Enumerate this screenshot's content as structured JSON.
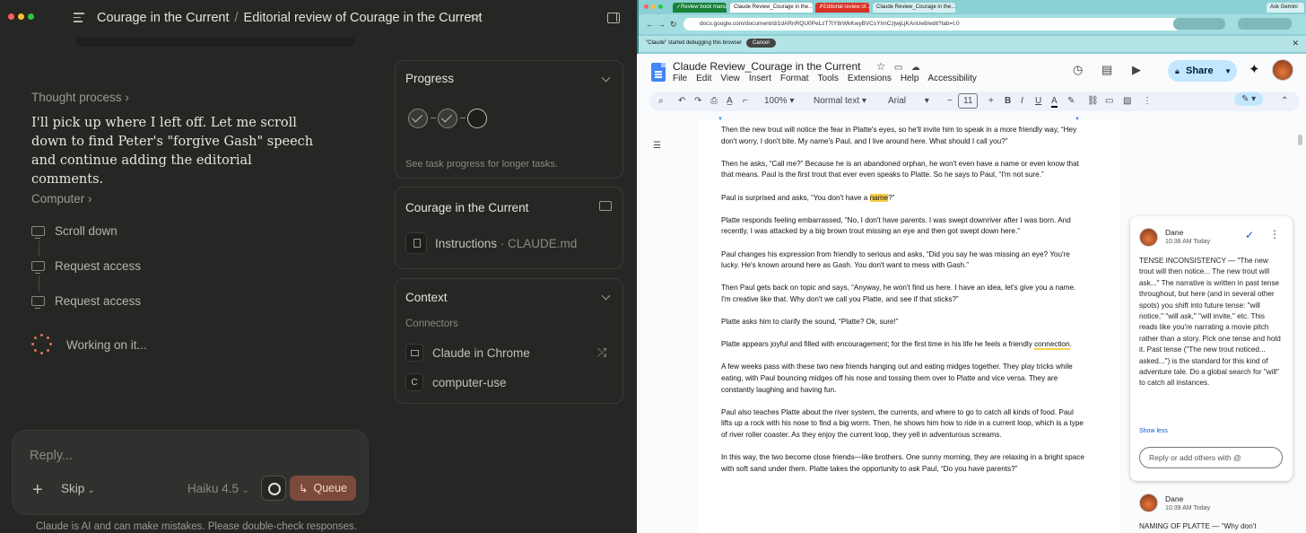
{
  "claude": {
    "breadcrumb": {
      "project": "Courage in the Current",
      "separator": "/",
      "chat": "Editorial review of Courage in the Current"
    },
    "thought_process": "Thought process",
    "message": "I'll pick up where I left off. Let me scroll down to find Peter's \"forgive Gash\" speech and continue adding the editorial comments.",
    "computer_label": "Computer",
    "steps": [
      "Scroll down",
      "Request access",
      "Request access"
    ],
    "working": "Working on it...",
    "progress": {
      "title": "Progress",
      "hint": "See task progress for longer tasks."
    },
    "project_card": {
      "title": "Courage in the Current",
      "file": "Instructions",
      "file_sep": " · ",
      "file_name": "CLAUDE.md"
    },
    "context": {
      "title": "Context",
      "connectors_label": "Connectors",
      "connectors": [
        {
          "name": "Claude in Chrome",
          "icon": "monitor-icon"
        },
        {
          "name": "computer-use",
          "icon": "c-icon"
        }
      ]
    },
    "composer": {
      "placeholder": "Reply...",
      "skip": "Skip",
      "model": "Haiku 4.5",
      "queue": "Queue"
    },
    "disclaimer": "Claude is AI and can make mistakes. Please double-check responses."
  },
  "browser": {
    "tabs": [
      "✓Review book manu…",
      "Claude Review_Courage in the…",
      "✗Editorial review of…",
      "Claude Review_Courage in the…",
      "Ask Gemini"
    ],
    "tab_colors": [
      "#188038",
      "#ffffff",
      "#d93025",
      "#d7f0f1",
      "#d7f0f1"
    ],
    "url": "docs.google.com/document/d/1dARnRQU0PeLzT7tY8rWkKwyBVCsYImCzjwjLjKAnUe8/edit?tab=t.0",
    "debug_text": "\"Claude\" started debugging this browser",
    "cancel": "Cancel"
  },
  "doc": {
    "title": "Claude Review_Courage in the Current",
    "menu": [
      "File",
      "Edit",
      "View",
      "Insert",
      "Format",
      "Tools",
      "Extensions",
      "Help",
      "Accessibility"
    ],
    "share": "Share",
    "zoom": "100%",
    "style": "Normal text",
    "font": "Arial",
    "font_size": "11",
    "paragraphs": {
      "p1": "Then the new trout will notice the fear in Platte's eyes, so he'll invite him to speak in a more friendly way, “Hey don't worry, I don't bite. My name's Paul, and I live around here. What should I call you?”",
      "p2": "Then he asks, “Call me?” Because he is an abandoned orphan, he won't even have a name or even know that that means. Paul is the first trout that ever even speaks to Platte. So he says to Paul, “I'm not sure.”",
      "p3a": "Paul is surprised and asks, “You don't have a ",
      "p3hl": "name",
      "p3b": "?”",
      "p4": "Platte responds feeling embarrassed, “No, I don't have parents. I was swept downriver after I was born. And recently, I was attacked by a big brown trout missing an eye and then got swept down here.”",
      "p5": "Paul changes his expression from friendly to serious and asks, “Did you say he was missing an eye? You're lucky. He's known around here as Gash. You don't want to mess with Gash.”",
      "p6": "Then Paul gets back on topic and says, “Anyway, he won't find us here. I have an idea, let's give you a name. I'm creative like that. Why don't we call you Platte, and see if that sticks?”",
      "p7": "Platte asks him to clarify the sound, “Platte? Ok, sure!”",
      "p8a": "Platte appears joyful and filled with encouragement; for the first time in his life he feels a friendly ",
      "p8hl": "connection",
      "p8b": ".",
      "p9": "A few weeks pass with these two new friends hanging out and eating midges together. They play tricks while eating, with Paul bouncing midges off his nose and tossing them over to Platte and vice versa. They are constantly laughing and having fun.",
      "p10": "Paul also teaches Platte about the river system, the currents, and where to go to catch all kinds of food. Paul lifts up a rock with his nose to find a big worm. Then, he shows him how to ride in a current loop, which is a type of river roller coaster. As they enjoy the current loop, they yell in adventurous screams.",
      "p11": "In this way, the two become close friends—like brothers. One sunny morning, they are relaxing in a bright space with soft sand under them. Platte takes the opportunity to ask Paul, “Do you have parents?”"
    },
    "comments": [
      {
        "author": "Dane",
        "time": "10:38 AM Today",
        "text": "TENSE INCONSISTENCY — \"The new trout will then notice... The new trout will ask...\" The narrative is written in past tense throughout, but here (and in several other spots) you shift into future tense: \"will notice,\" \"will ask,\" \"will invite,\" etc. This reads like you're narrating a movie pitch rather than a story. Pick one tense and hold it. Past tense (\"The new trout noticed... asked...\") is the standard for this kind of adventure tale. Do a global search for \"will\" to catch all instances.",
        "show_less": "Show less",
        "reply_placeholder": "Reply or add others with @"
      },
      {
        "author": "Dane",
        "time": "10:39 AM Today",
        "text": "NAMING OF PLATTE — “Why don't"
      }
    ]
  }
}
